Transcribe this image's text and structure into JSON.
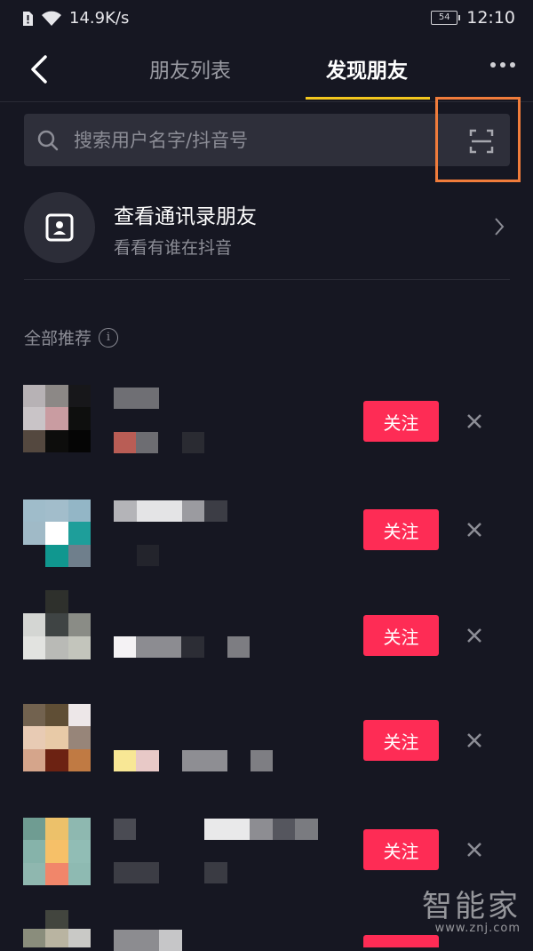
{
  "status": {
    "network_speed": "14.9K/s",
    "battery": "54",
    "time": "12:10"
  },
  "nav": {
    "tab_friends_list": "朋友列表",
    "tab_discover": "发现朋友"
  },
  "search": {
    "placeholder": "搜索用户名字/抖音号"
  },
  "contacts": {
    "title": "查看通讯录朋友",
    "subtitle": "看看有谁在抖音"
  },
  "section": {
    "title": "全部推荐",
    "info": "i"
  },
  "follow_label": "关注",
  "watermark": {
    "name": "智能家",
    "url": "www.znj.com"
  },
  "colors": {
    "accent": "#fe2c55",
    "tab_underline": "#f3c71e",
    "highlight": "#f07c3b",
    "background": "#161722"
  }
}
